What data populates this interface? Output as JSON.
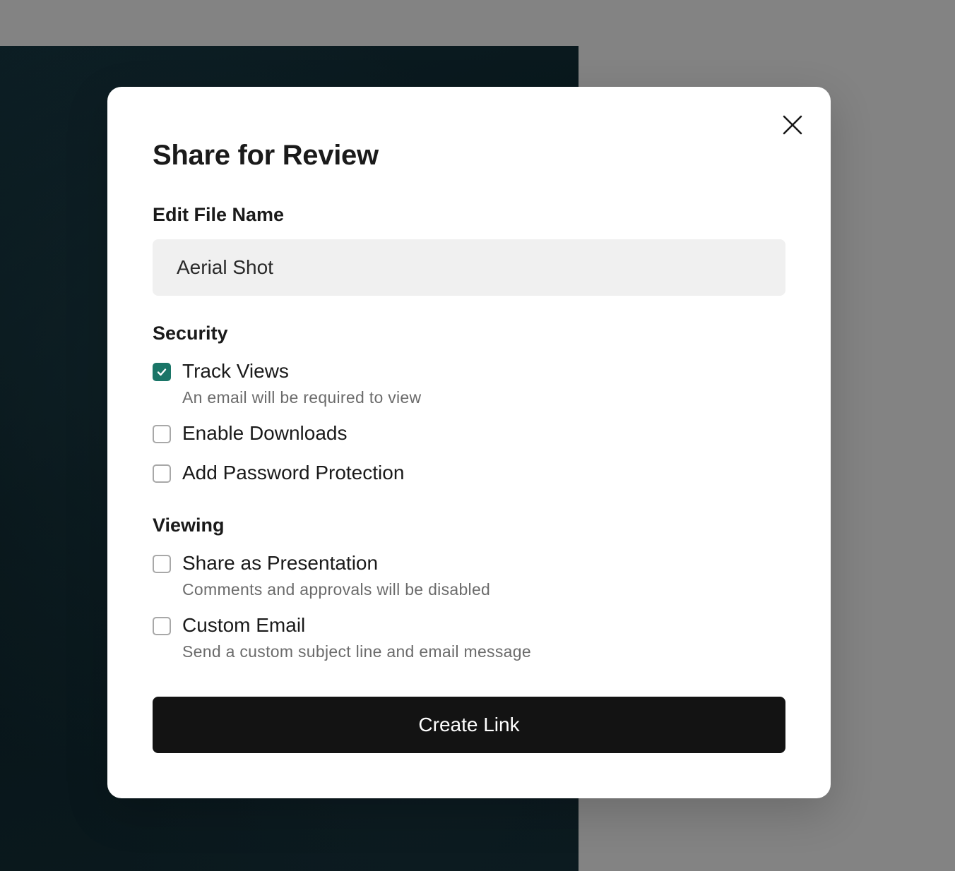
{
  "dialog": {
    "title": "Share for Review",
    "close_icon": "close-icon",
    "file_name": {
      "label": "Edit File Name",
      "value": "Aerial Shot"
    },
    "security": {
      "heading": "Security",
      "options": [
        {
          "label": "Track Views",
          "description": "An email will be required to view",
          "checked": true
        },
        {
          "label": "Enable Downloads",
          "checked": false
        },
        {
          "label": "Add Password Protection",
          "checked": false
        }
      ]
    },
    "viewing": {
      "heading": "Viewing",
      "options": [
        {
          "label": "Share as Presentation",
          "description": "Comments and approvals will be disabled",
          "checked": false
        },
        {
          "label": "Custom Email",
          "description": "Send a custom subject line and email message",
          "checked": false
        }
      ]
    },
    "submit_label": "Create Link"
  },
  "colors": {
    "accent_checked": "#1a7567",
    "primary_button": "#131313",
    "overlay": "#838383"
  }
}
